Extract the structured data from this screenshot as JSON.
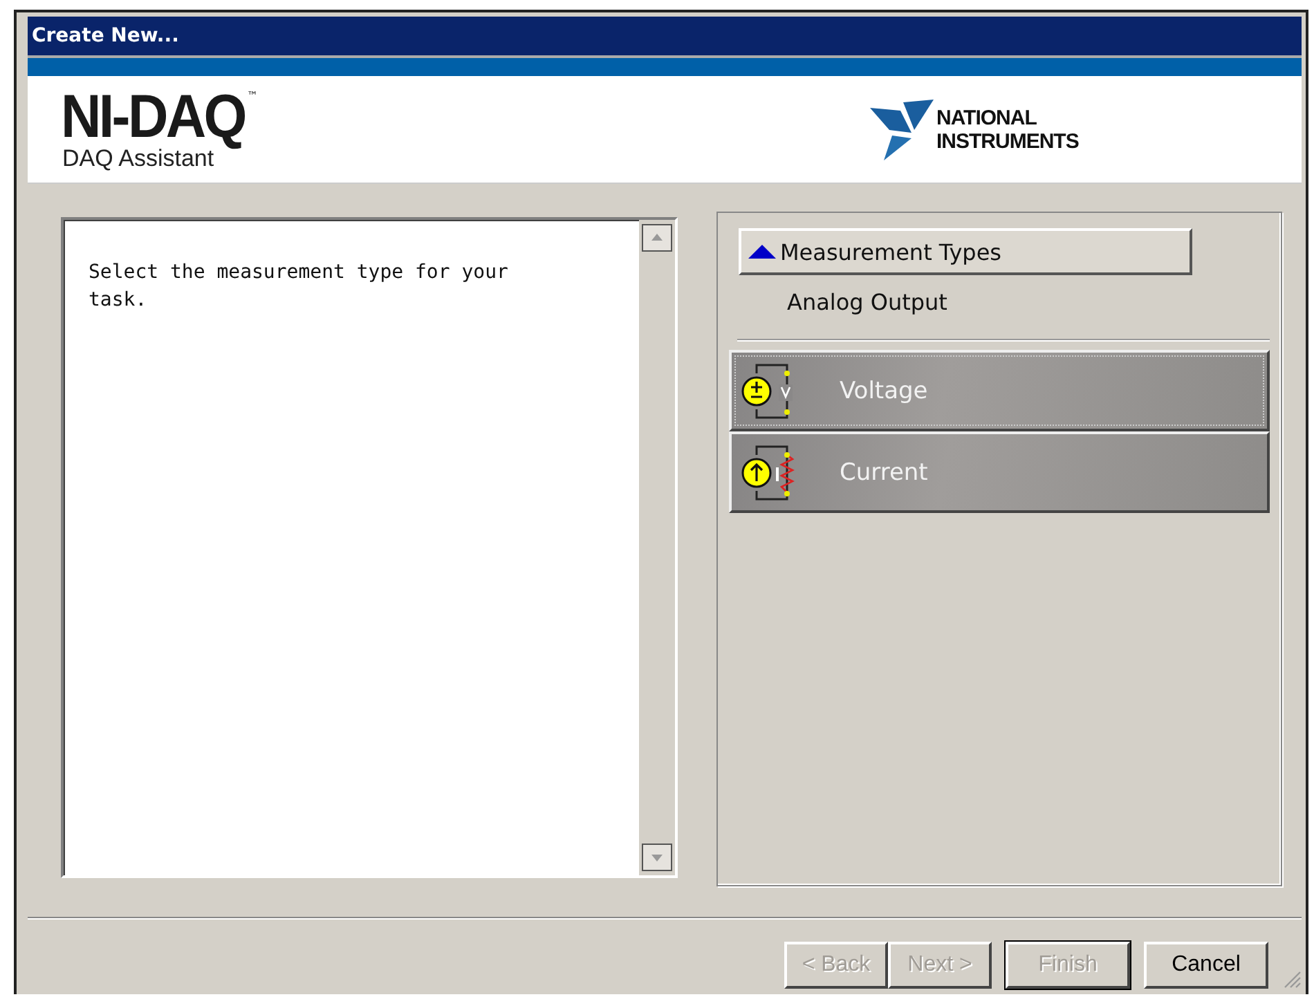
{
  "window": {
    "title": "Create New..."
  },
  "header": {
    "product": "NI-DAQ",
    "product_mark": "™",
    "subtitle": "DAQ Assistant",
    "vendor_line_1": "NATIONAL",
    "vendor_line_2": "INSTRUMENTS"
  },
  "help_text": "Select the measurement type for your task.",
  "measurement_types": {
    "label": "Measurement Types",
    "expanded": true,
    "category": "Analog Output",
    "items": [
      {
        "label": "Voltage",
        "kind": "voltage",
        "selected": true
      },
      {
        "label": "Current",
        "kind": "current",
        "selected": false
      }
    ]
  },
  "buttons": [
    {
      "label": "< Back",
      "disabled": true,
      "default": false,
      "kind": "paired"
    },
    {
      "label": "Next >",
      "disabled": true,
      "default": false,
      "kind": "paired"
    },
    {
      "label": "Finish",
      "disabled": true,
      "default": true,
      "kind": "single"
    },
    {
      "label": "Cancel",
      "disabled": false,
      "default": false,
      "kind": "single"
    }
  ]
}
